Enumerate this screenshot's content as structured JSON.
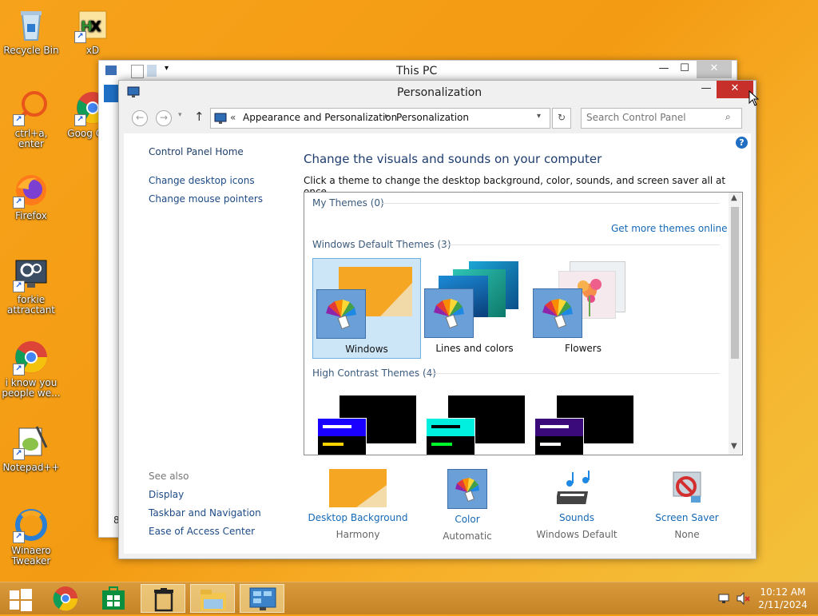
{
  "desktop": {
    "icons": [
      {
        "label": "Recycle Bin"
      },
      {
        "label": "xD"
      },
      {
        "label": "ctrl+a, enter"
      },
      {
        "label": "Goog Chro"
      },
      {
        "label": "Firefox"
      },
      {
        "label": "forkie attractant"
      },
      {
        "label": "i know you people we..."
      },
      {
        "label": "Notepad++"
      },
      {
        "label": "Winaero Tweaker"
      }
    ]
  },
  "this_pc": {
    "title": "This PC",
    "minimize": "—",
    "maximize": "☐",
    "close": "✕",
    "status_char": "8"
  },
  "window": {
    "title": "Personalization",
    "minimize": "—",
    "maximize": "☐",
    "close": "✕",
    "address": {
      "prefix": "«",
      "crumb1": "Appearance and Personalization",
      "sep": "▸",
      "crumb2": "Personalization"
    },
    "search_placeholder": "Search Control Panel",
    "left_nav": {
      "home": "Control Panel Home",
      "items": [
        "Change desktop icons",
        "Change mouse pointers"
      ],
      "see_also_label": "See also",
      "see_also": [
        "Display",
        "Taskbar and Navigation",
        "Ease of Access Center"
      ]
    },
    "main": {
      "heading": "Change the visuals and sounds on your computer",
      "sub": "Click a theme to change the desktop background, color, sounds, and screen saver all at once.",
      "my_themes": "My Themes (0)",
      "get_more": "Get more themes online",
      "default_themes": "Windows Default Themes (3)",
      "themes": [
        {
          "name": "Windows"
        },
        {
          "name": "Lines and colors"
        },
        {
          "name": "Flowers"
        }
      ],
      "high_contrast": "High Contrast Themes (4)"
    },
    "bottom": [
      {
        "title": "Desktop Background",
        "value": "Harmony"
      },
      {
        "title": "Color",
        "value": "Automatic"
      },
      {
        "title": "Sounds",
        "value": "Windows Default"
      },
      {
        "title": "Screen Saver",
        "value": "None"
      }
    ]
  },
  "taskbar": {
    "time": "10:12 AM",
    "date": "2/11/2024"
  },
  "colors": {
    "accent": "#1568b5",
    "close": "#c7302a",
    "desktop": "#f7a21b"
  }
}
